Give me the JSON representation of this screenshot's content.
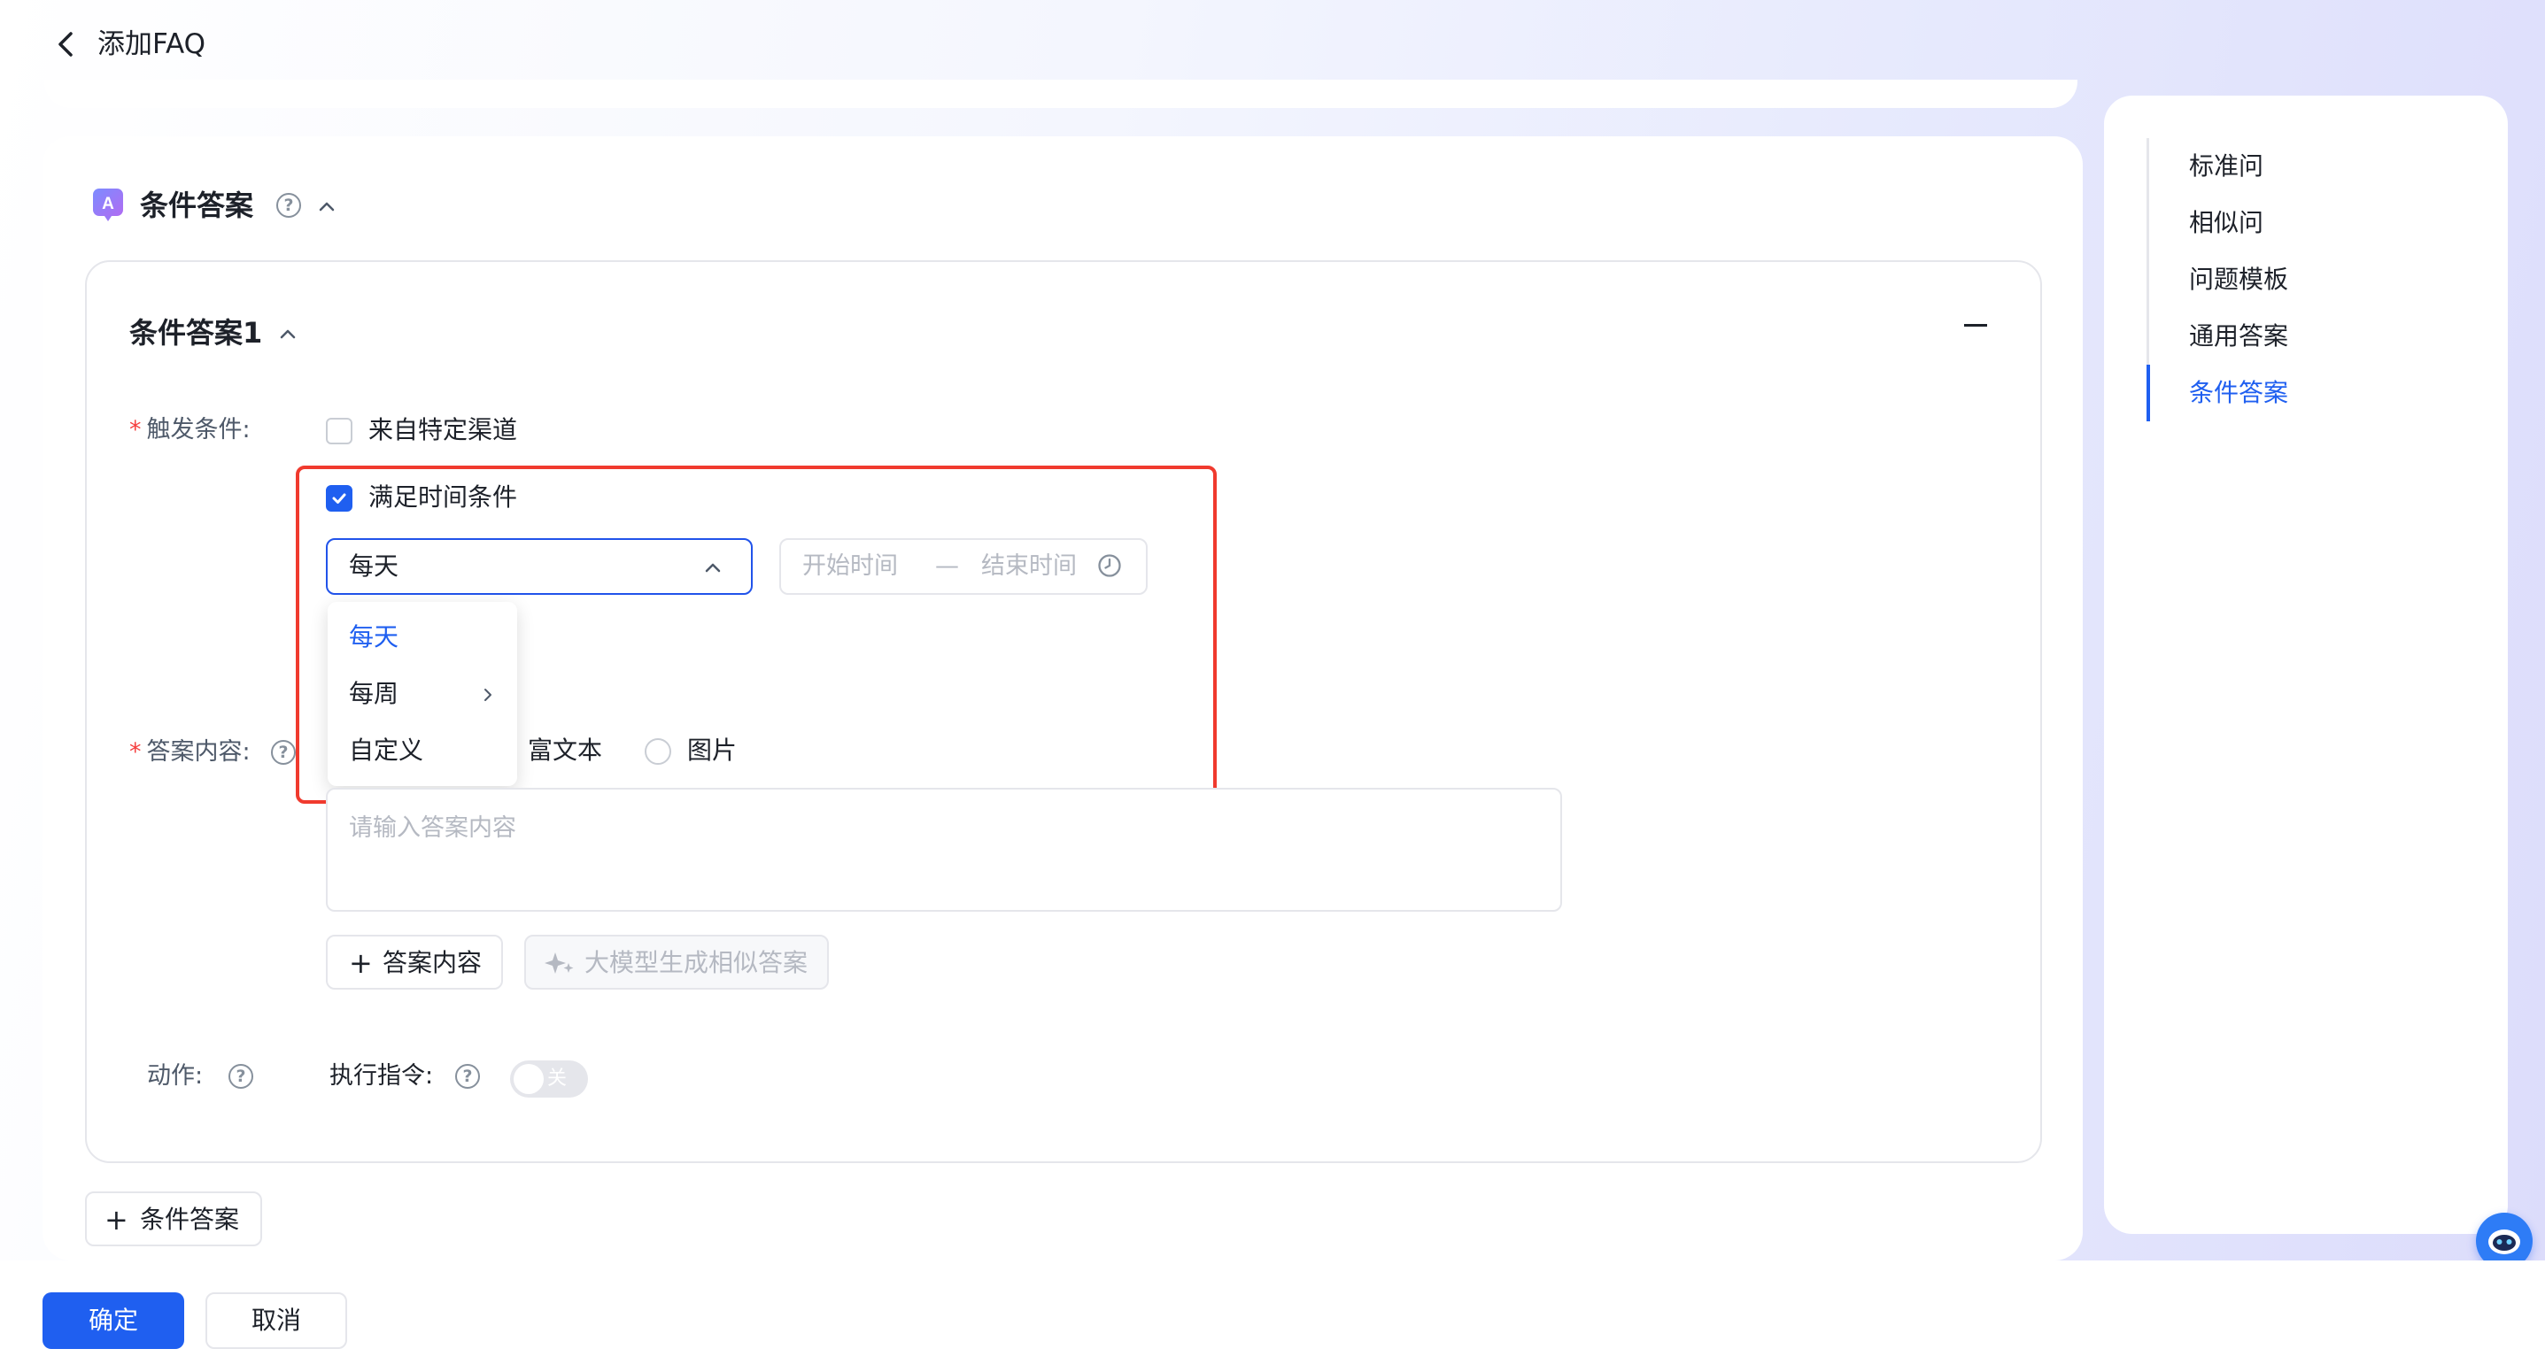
{
  "header": {
    "title": "添加FAQ"
  },
  "section": {
    "title": "条件答案",
    "help": "?"
  },
  "condition": {
    "title": "条件答案1",
    "trigger_label": "触发条件:",
    "required_mark": "*",
    "channel_option": "来自特定渠道",
    "time_option": "满足时间条件",
    "frequency_value": "每天",
    "start_placeholder": "开始时间",
    "separator": "—",
    "end_placeholder": "结束时间",
    "dropdown_options": [
      "每天",
      "每周",
      "自定义"
    ],
    "answer_label": "答案内容:",
    "answer_types": [
      "富文本",
      "图片"
    ],
    "answer_placeholder": "请输入答案内容",
    "add_answer_button": "答案内容",
    "ai_generate_button": "大模型生成相似答案",
    "action_label": "动作:",
    "command_label": "执行指令:",
    "toggle_text": "关"
  },
  "add_condition_button": "条件答案",
  "nav": {
    "items": [
      "标准问",
      "相似问",
      "问题模板",
      "通用答案",
      "条件答案"
    ],
    "active_index": 4
  },
  "footer": {
    "confirm": "确定",
    "cancel": "取消"
  },
  "colors": {
    "primary": "#1f5ff0",
    "highlight_box": "#f03a2e"
  }
}
